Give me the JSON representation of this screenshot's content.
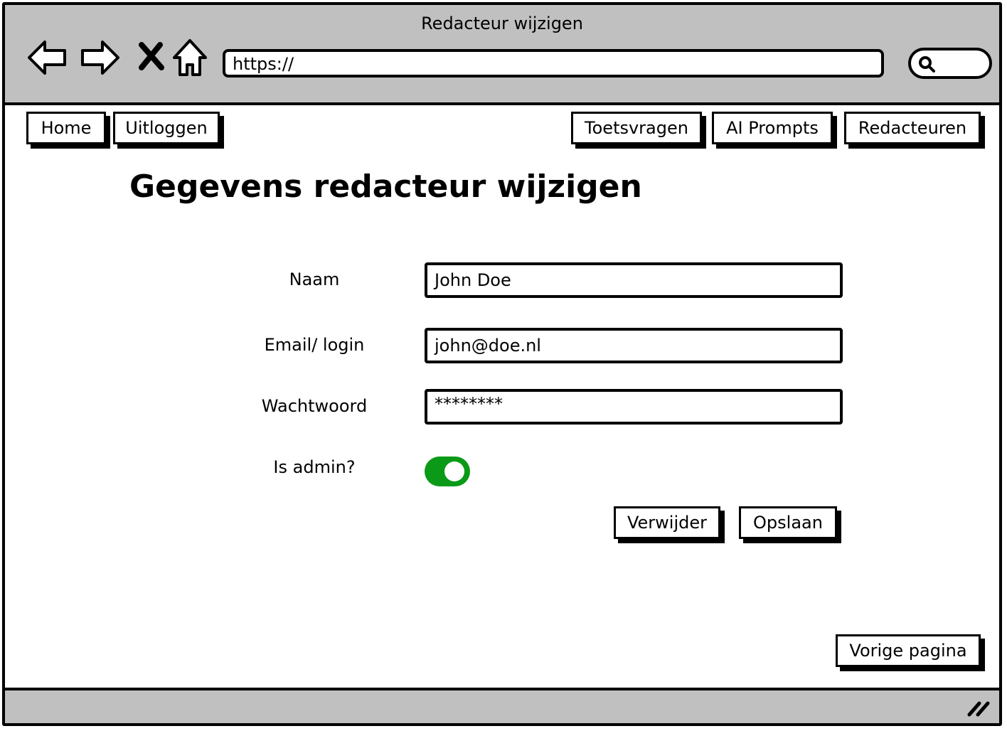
{
  "window": {
    "title": "Redacteur wijzigen"
  },
  "browser": {
    "address": "https://",
    "icons": [
      "back-arrow-icon",
      "forward-arrow-icon",
      "close-icon",
      "home-icon",
      "search-icon"
    ]
  },
  "nav": {
    "left": [
      {
        "label": "Home"
      },
      {
        "label": "Uitloggen"
      }
    ],
    "right": [
      {
        "label": "Toetsvragen"
      },
      {
        "label": "AI Prompts"
      },
      {
        "label": "Redacteuren"
      }
    ]
  },
  "page": {
    "title": "Gegevens redacteur wijzigen"
  },
  "form": {
    "name": {
      "label": "Naam",
      "value": "John Doe"
    },
    "email": {
      "label": "Email/ login",
      "value": "john@doe.nl"
    },
    "password": {
      "label": "Wachtwoord",
      "value": "********"
    },
    "admin": {
      "label": "Is admin?",
      "checked": true,
      "color": "#0a9a17"
    },
    "delete_label": "Verwijder",
    "save_label": "Opslaan"
  },
  "footer": {
    "back_label": "Vorige pagina"
  }
}
